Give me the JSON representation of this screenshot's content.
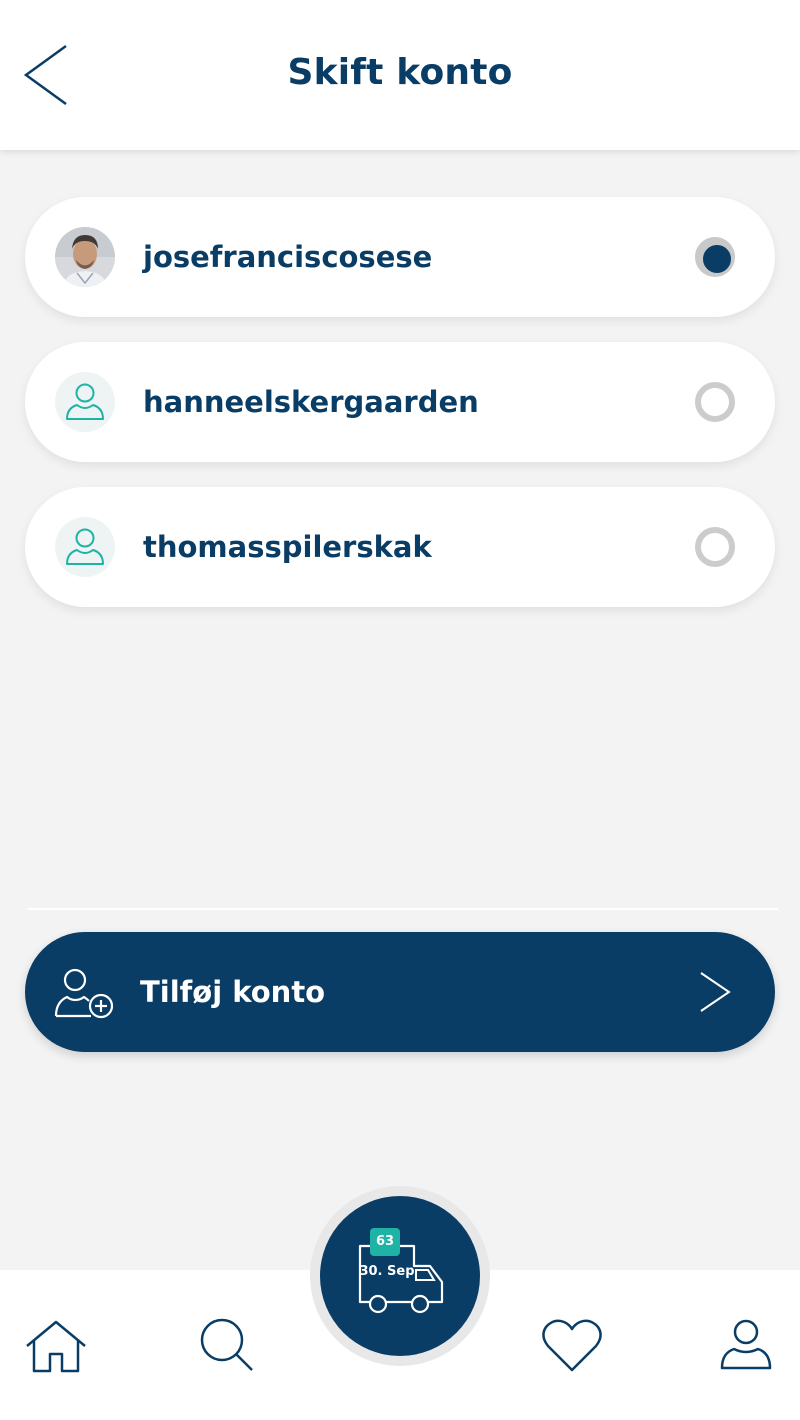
{
  "header": {
    "title": "Skift konto",
    "back_icon": "chevron-left-icon"
  },
  "accounts": [
    {
      "username": "josefranciscosese",
      "avatar": "photo",
      "selected": true
    },
    {
      "username": "hanneelskergaarden",
      "avatar": "person-icon",
      "selected": false
    },
    {
      "username": "thomasspilerskak",
      "avatar": "person-icon",
      "selected": false
    }
  ],
  "add_account": {
    "label": "Tilføj konto",
    "icon": "add-person-icon",
    "chevron_icon": "chevron-right-icon"
  },
  "delivery": {
    "badge_count": "63",
    "date": "30. Sep",
    "icon": "delivery-truck-icon"
  },
  "tabbar": {
    "items": [
      "home-icon",
      "search-icon",
      "heart-icon",
      "profile-icon"
    ]
  },
  "colors": {
    "primary": "#0a3d66",
    "accent": "#1fb3a6",
    "background": "#f3f3f3",
    "radio_border": "#cccccc"
  }
}
